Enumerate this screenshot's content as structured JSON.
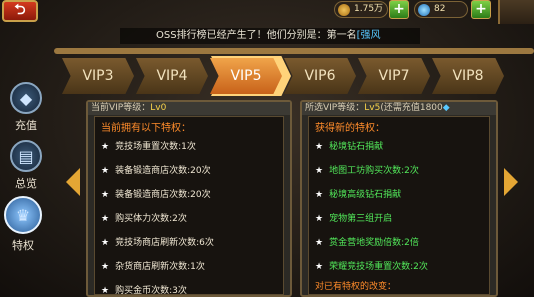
{
  "marquee": {
    "prefix": "OSS排行榜已经产生了！他们分别是：第一名",
    "name": "[强风"
  },
  "resources": {
    "gold": "1.75万",
    "diamonds": "82",
    "plus": "+"
  },
  "back": {
    "icon": "⮌"
  },
  "tabs": [
    "VIP3",
    "VIP4",
    "VIP5",
    "VIP6",
    "VIP7",
    "VIP8"
  ],
  "active_tab": "VIP5",
  "sidenav": [
    {
      "label": "充值",
      "icon": "diamond-icon"
    },
    {
      "label": "总览",
      "icon": "scroll-icon"
    },
    {
      "label": "特权",
      "icon": "crown-icon"
    }
  ],
  "left_panel": {
    "head_prefix": "当前VIP等级：",
    "head_level": "Lv0",
    "section_title": "当前拥有以下特权：",
    "rows": [
      "竞技场重置次数:1次",
      "装备锻造商店次数:20次",
      "装备锻造商店次数:20次",
      "购买体力次数:2次",
      "竞技场商店刷新次数:6次",
      "杂货商店刷新次数:1次",
      "购买金币次数:3次"
    ]
  },
  "right_panel": {
    "head_prefix": "所选VIP等级：",
    "head_level": "Lv5",
    "head_note": "(还需充值1800",
    "section_title": "获得新的特权：",
    "rows": [
      "秘境钻石捐献",
      "地图工坊购买次数:2次",
      "秘境高级钻石捐献",
      "宠物第三组开启",
      "赏金营地奖励倍数:2倍",
      "荣耀竞技场重置次数:2次"
    ],
    "footer": "对已有特权的改变："
  },
  "colors": {
    "accent_orange": "#ff8c2b",
    "privilege_green": "#52e85a",
    "level_yellow": "#f7d24a",
    "name_blue": "#58c8ff"
  }
}
